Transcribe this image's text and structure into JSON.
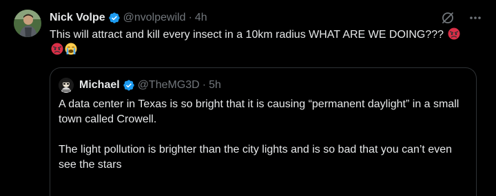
{
  "tweet": {
    "display_name": "Nick Volpe",
    "handle": "@nvolpewild",
    "separator": "·",
    "time": "4h",
    "text": "This will attract and kill every insect in a 10km radius WHAT ARE WE DOING???",
    "emojis": [
      "angry-face",
      "angry-face",
      "crying-face"
    ]
  },
  "quote": {
    "display_name": "Michael",
    "handle": "@TheMG3D",
    "separator": "·",
    "time": "5h",
    "text": "A data center in Texas is so bright that it is causing “permanent daylight” in a small town called Crowell.\n\nThe light pollution is brighter than the city lights and is so bad that you can’t even see the stars"
  },
  "actions": {
    "grok_icon": "grok-slash-icon",
    "more_icon": "more-dots-icon"
  },
  "colors": {
    "background": "#000000",
    "text": "#e7e9ea",
    "secondary": "#71767b",
    "verified": "#1d9bf0",
    "border": "#2f3336"
  }
}
